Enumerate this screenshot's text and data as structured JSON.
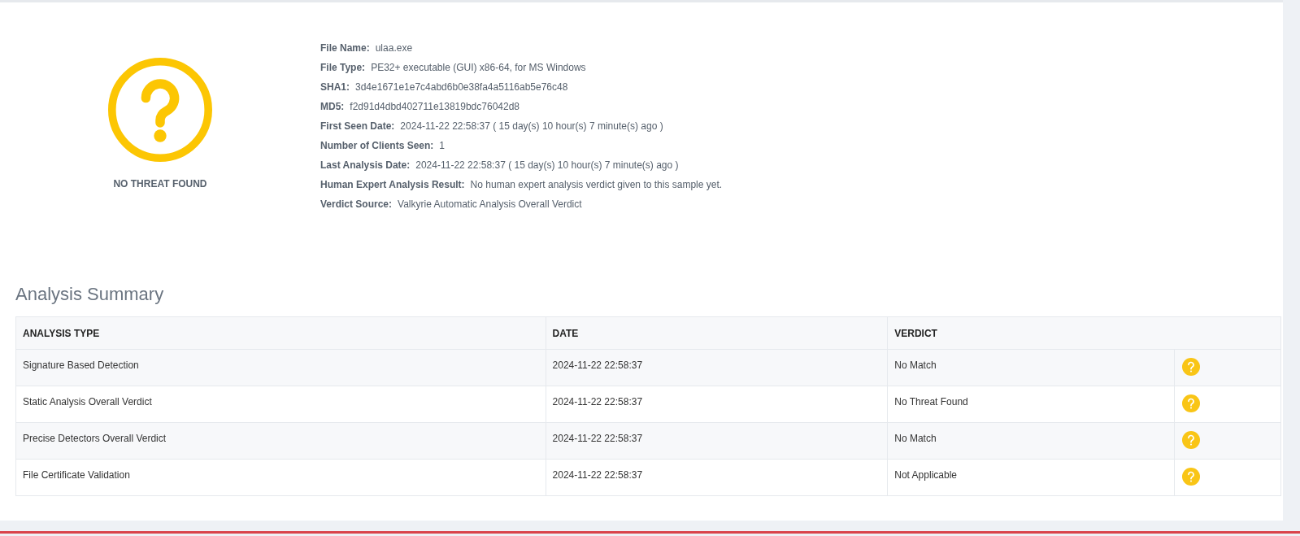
{
  "result": {
    "label": "NO THREAT FOUND"
  },
  "details": [
    {
      "label": "File Name:",
      "value": "ulaa.exe"
    },
    {
      "label": "File Type:",
      "value": "PE32+ executable (GUI) x86-64, for MS Windows"
    },
    {
      "label": "SHA1:",
      "value": "3d4e1671e1e7c4abd6b0e38fa4a5116ab5e76c48"
    },
    {
      "label": "MD5:",
      "value": "f2d91d4dbd402711e13819bdc76042d8"
    },
    {
      "label": "First Seen Date:",
      "value": "2024-11-22 22:58:37 ( 15 day(s) 10 hour(s) 7 minute(s) ago )"
    },
    {
      "label": "Number of Clients Seen:",
      "value": "1"
    },
    {
      "label": "Last Analysis Date:",
      "value": "2024-11-22 22:58:37 ( 15 day(s) 10 hour(s) 7 minute(s) ago )"
    },
    {
      "label": "Human Expert Analysis Result:",
      "value": "No human expert analysis verdict given to this sample yet."
    },
    {
      "label": "Verdict Source:",
      "value": "Valkyrie Automatic Analysis Overall Verdict"
    }
  ],
  "analysis_summary": {
    "title": "Analysis Summary",
    "columns": [
      "ANALYSIS TYPE",
      "DATE",
      "VERDICT"
    ],
    "rows": [
      {
        "analysis_type": "Signature Based Detection",
        "date": "2024-11-22 22:58:37",
        "verdict": "No Match"
      },
      {
        "analysis_type": "Static Analysis Overall Verdict",
        "date": "2024-11-22 22:58:37",
        "verdict": "No Threat Found"
      },
      {
        "analysis_type": "Precise Detectors Overall Verdict",
        "date": "2024-11-22 22:58:37",
        "verdict": "No Match"
      },
      {
        "analysis_type": "File Certificate Validation",
        "date": "2024-11-22 22:58:37",
        "verdict": "Not Applicable"
      }
    ]
  }
}
